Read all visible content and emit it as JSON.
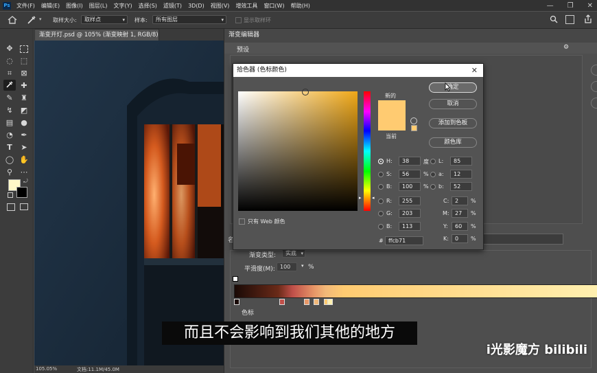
{
  "menu": {
    "logo": "Ps",
    "items": [
      "文件(F)",
      "编辑(E)",
      "图像(I)",
      "图层(L)",
      "文字(Y)",
      "选择(S)",
      "滤镜(T)",
      "3D(D)",
      "视图(V)",
      "增效工具",
      "窗口(W)",
      "帮助(H)"
    ]
  },
  "options": {
    "sample_size_label": "取样大小:",
    "sample_size_value": "取样点",
    "sample_label": "样本:",
    "sample_value": "所有图层",
    "show_ring_label": "显示取样环"
  },
  "document": {
    "tab_title": "渐变开灯.psd @ 105% (渐变映射 1, RGB/8) *",
    "zoom": "105.05%",
    "doc_info": "文档:11.1M/45.0M"
  },
  "gradient_editor": {
    "title": "渐变编辑器",
    "presets_label": "预设",
    "name_label": "名",
    "gradient_type_label": "渐变类型:",
    "gradient_type_value": "实底",
    "smoothness_label": "平滑度(M):",
    "smoothness_value": "100",
    "smoothness_unit": "%",
    "color_stops_label": "色标",
    "stop_colors": [
      "#1a0a06",
      "#c0504a",
      "#e89868",
      "#f2b878",
      "#ffcb71",
      "#fff0b0"
    ]
  },
  "color_picker": {
    "title": "拾色器 (色标颜色)",
    "ok": "确定",
    "cancel": "取消",
    "add_to_swatches": "添加到色板",
    "color_libraries": "颜色库",
    "new_label": "新的",
    "current_label": "当前",
    "only_web_colors": "只有 Web 颜色",
    "new_color": "#ffcb71",
    "current_color": "#ffcb71",
    "hsb": {
      "H": "38",
      "H_unit": "度",
      "S": "56",
      "S_unit": "%",
      "B": "100",
      "B_unit": "%"
    },
    "rgb": {
      "R": "255",
      "G": "203",
      "B": "113"
    },
    "lab": {
      "L": "85",
      "a": "12",
      "b": "52"
    },
    "cmyk": {
      "C": "2",
      "M": "27",
      "Y": "60",
      "K": "0",
      "unit": "%"
    },
    "hex": "ffcb71",
    "hex_label": "#"
  },
  "subtitle": "而且不会影响到我们其他的地方",
  "watermark": "i光影魔方 bilibili",
  "colors": {
    "menubar": "#323232",
    "panel": "#535353",
    "accent_blue": "#31a8ff",
    "foreground_swatch": "#fff8c8",
    "background_swatch": "#000000"
  }
}
